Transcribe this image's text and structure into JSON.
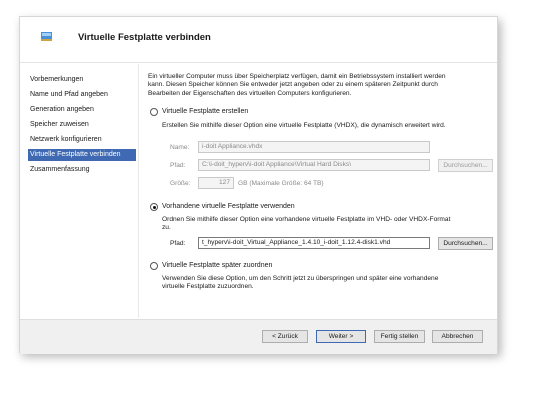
{
  "title": "Virtuelle Festplatte verbinden",
  "sidebar": {
    "items": [
      {
        "label": "Vorbemerkungen"
      },
      {
        "label": "Name und Pfad angeben"
      },
      {
        "label": "Generation angeben"
      },
      {
        "label": "Speicher zuweisen"
      },
      {
        "label": "Netzwerk konfigurieren"
      },
      {
        "label": "Virtuelle Festplatte verbinden"
      },
      {
        "label": "Zusammenfassung"
      }
    ],
    "active_index": 5
  },
  "intro": {
    "line1": "Ein virtueller Computer muss über Speicherplatz verfügen, damit ein Betriebssystem installiert werden",
    "line2": "kann. Diesen Speicher können Sie entweder jetzt angeben oder zu einem späteren Zeitpunkt durch",
    "line3": "Bearbeiten der Eigenschaften des virtuellen Computers konfigurieren."
  },
  "option_create": {
    "label": "Virtuelle Festplatte erstellen",
    "description": "Erstellen Sie mithilfe dieser Option eine virtuelle Festplatte (VHDX), die dynamisch erweitert wird.",
    "name_label": "Name:",
    "name_value": "i-doit Appliance.vhdx",
    "path_label": "Pfad:",
    "path_value": "C:\\i-doit_hyperv\\i-doit Appliance\\Virtual Hard Disks\\",
    "browse_label": "Durchsuchen...",
    "size_label": "Größe:",
    "size_value": "127",
    "size_unit": "GB (Maximale Größe: 64 TB)"
  },
  "option_existing": {
    "label": "Vorhandene virtuelle Festplatte verwenden",
    "description_line1": "Ordnen Sie mithilfe dieser Option eine vorhandene virtuelle Festplatte im VHD- oder VHDX-Format",
    "description_line2": "zu.",
    "path_label": "Pfad:",
    "path_value": "t_hyperv\\i-doit_Virtual_Appliance_1.4.10_i-doit_1.12.4-disk1.vhd",
    "browse_label": "Durchsuchen..."
  },
  "option_later": {
    "label": "Virtuelle Festplatte später zuordnen",
    "description_line1": "Verwenden Sie diese Option, um den Schritt jetzt zu überspringen und später eine vorhandene",
    "description_line2": "virtuelle Festplatte zuzuordnen."
  },
  "selected_option": "existing",
  "footer": {
    "back": "< Zurück",
    "next": "Weiter >",
    "finish": "Fertig stellen",
    "cancel": "Abbrechen"
  }
}
